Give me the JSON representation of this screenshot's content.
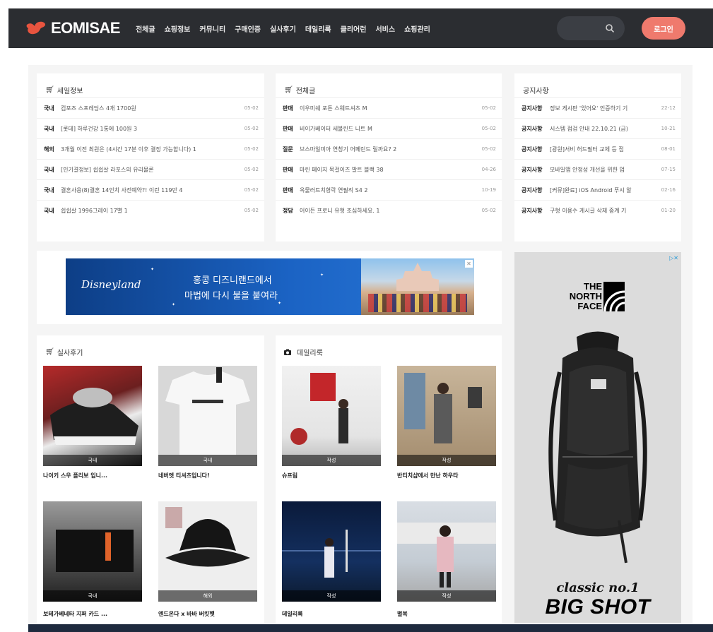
{
  "header": {
    "logo_text": "EOMISAE",
    "nav": [
      "전체글",
      "쇼핑정보",
      "커뮤니티",
      "구매인증",
      "실사후기",
      "데일리룩",
      "클리어런",
      "서비스",
      "쇼핑관리"
    ],
    "login_label": "로그인",
    "colors": {
      "bg": "#2b2d31",
      "accent": "#ef7a6d",
      "logo": "#e8543f"
    }
  },
  "sale_panel": {
    "title": "세일정보",
    "icon": "cart-icon",
    "rows": [
      {
        "cat": "국내",
        "title": "컴포즈 스프레딩스 4개 1700원",
        "date": "05-02"
      },
      {
        "cat": "국내",
        "title": "[롯데] 하루건강 1통에 100원 3",
        "date": "05-02"
      },
      {
        "cat": "해외",
        "title": "3개월 이전 최원은 (4시간 17분 이후 결정 가능합니다) 1",
        "date": "05-02"
      },
      {
        "cat": "국내",
        "title": "[인기결정보] 쉽쉽살 라포스의 유리물론",
        "date": "05-02"
      },
      {
        "cat": "국내",
        "title": "결혼사용(8)결혼 14인치 사전예약?! 이런 119만 4",
        "date": "05-02"
      },
      {
        "cat": "국내",
        "title": "쉽쉽살 1996그레이 17별 1",
        "date": "05-02"
      }
    ]
  },
  "all_panel": {
    "title": "전체글",
    "icon": "cart-icon",
    "rows": [
      {
        "cat": "판매",
        "title": "이우미쉐 포튼 스웨트셔츠 M",
        "date": "05-02"
      },
      {
        "cat": "판매",
        "title": "비이가베이터 세볼린드 니트 M",
        "date": "05-02"
      },
      {
        "cat": "질문",
        "title": "브스마일미아 연청기 어페린드 릴까요? 2",
        "date": "05-02"
      },
      {
        "cat": "판매",
        "title": "마린 페이지 목걸이즈 발트 블랙 38",
        "date": "04-26"
      },
      {
        "cat": "판매",
        "title": "옥물러트치형락 연필직 S4 2",
        "date": "10-19"
      },
      {
        "cat": "정담",
        "title": "어이든 프로니 유형 조심하세요. 1",
        "date": "05-02"
      }
    ]
  },
  "notice_panel": {
    "title": "공지사항",
    "rows": [
      {
        "cat": "공지사항",
        "title": "정보 게시판 '있어요' 인증하기 기",
        "date": "22-12"
      },
      {
        "cat": "공지사항",
        "title": "시스템 점검 안내 22.10.21 (금)",
        "date": "10-21"
      },
      {
        "cat": "공지사항",
        "title": "[광원]서비 허드필터 교체 등 점",
        "date": "08-01"
      },
      {
        "cat": "공지사항",
        "title": "모바일앱 안정성 개선을 위한 업",
        "date": "07-15"
      },
      {
        "cat": "공지사항",
        "title": "[커뮤]완료] iOS Android 푸시 알",
        "date": "02-16"
      },
      {
        "cat": "공지사항",
        "title": "구형 이용수 게시글 삭제 중계 기",
        "date": "01-20"
      }
    ]
  },
  "banner": {
    "logo": "Disneyland",
    "line1": "홍콩 디즈니랜드에서",
    "line2": "마법에 다시 불을 붙여라"
  },
  "review_panel": {
    "title": "실사후기",
    "icon": "cart-icon",
    "items": [
      {
        "tag": "국내",
        "caption": "나이키 스우 플리보 입니..."
      },
      {
        "tag": "국내",
        "caption": "네버엣 티셔츠입니다!"
      },
      {
        "tag": "국내",
        "caption": "보테가베네타 지퍼 카드 ..."
      },
      {
        "tag": "해외",
        "caption": "엔드온다 x 바바 버킷햇"
      }
    ]
  },
  "daily_panel": {
    "title": "데일리룩",
    "icon": "camera-icon",
    "items": [
      {
        "tag": "작성",
        "caption": "슈프림"
      },
      {
        "tag": "작성",
        "caption": "반티치샵에서 만난 하우타"
      },
      {
        "tag": "작성",
        "caption": "데일리룩"
      },
      {
        "tag": "작성",
        "caption": "별복"
      }
    ]
  },
  "side_ad": {
    "brand": "THE NORTH FACE",
    "tagline": "classic no.1",
    "headline": "BIG SHOT"
  }
}
